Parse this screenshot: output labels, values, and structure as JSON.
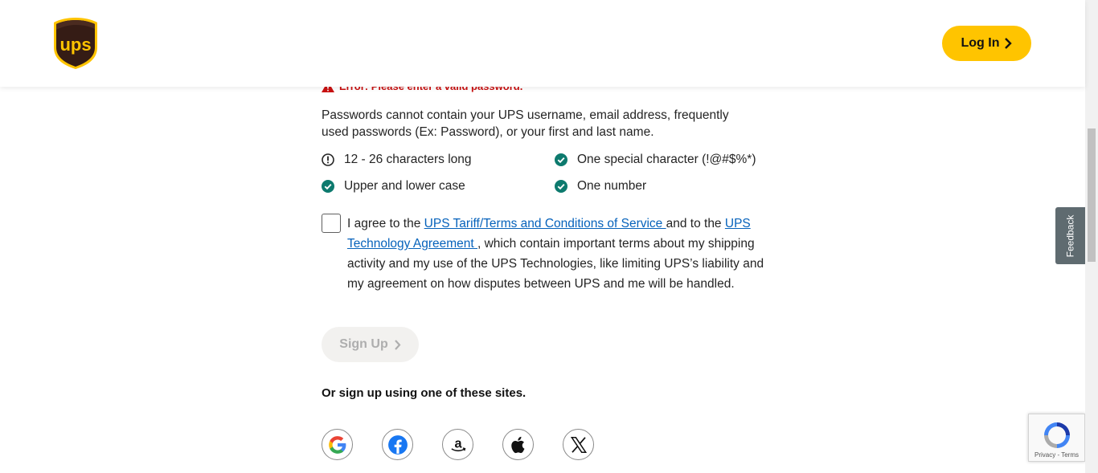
{
  "header": {
    "logo_text": "ups",
    "login_label": "Log In"
  },
  "form": {
    "error_text": "Error: Please enter a valid password.",
    "password_note": "Passwords cannot contain your UPS username, email address, frequently used passwords (Ex: Password), or your first and last name.",
    "requirements": [
      {
        "label": "12 - 26 characters long",
        "status": "error"
      },
      {
        "label": "One special character (!@#$%*)",
        "status": "met"
      },
      {
        "label": "Upper and lower case",
        "status": "met"
      },
      {
        "label": "One number",
        "status": "met"
      }
    ],
    "agreement": {
      "prefix": "I agree to the ",
      "link1": "UPS Tariff/Terms and Conditions of Service ",
      "middle": "and to the ",
      "link2": "UPS Technology Agreement ",
      "suffix": ", which contain important terms about my shipping activity and my use of the UPS Technologies, like limiting UPS’s liability and my agreement on how disputes between UPS and me will be handled.",
      "checked": false
    },
    "signup_label": "Sign Up",
    "social_heading": "Or sign up using one of these sites.",
    "social_providers": [
      "google-icon",
      "facebook-icon",
      "amazon-icon",
      "apple-icon",
      "x-icon"
    ]
  },
  "feedback_label": "Feedback",
  "recaptcha": {
    "privacy": "Privacy",
    "separator": " - ",
    "terms": "Terms"
  },
  "colors": {
    "brand_brown": "#351c15",
    "brand_gold": "#ffc400",
    "error_red": "#c91111",
    "success_teal": "#0d7a6e",
    "link_blue": "#0662bb"
  }
}
